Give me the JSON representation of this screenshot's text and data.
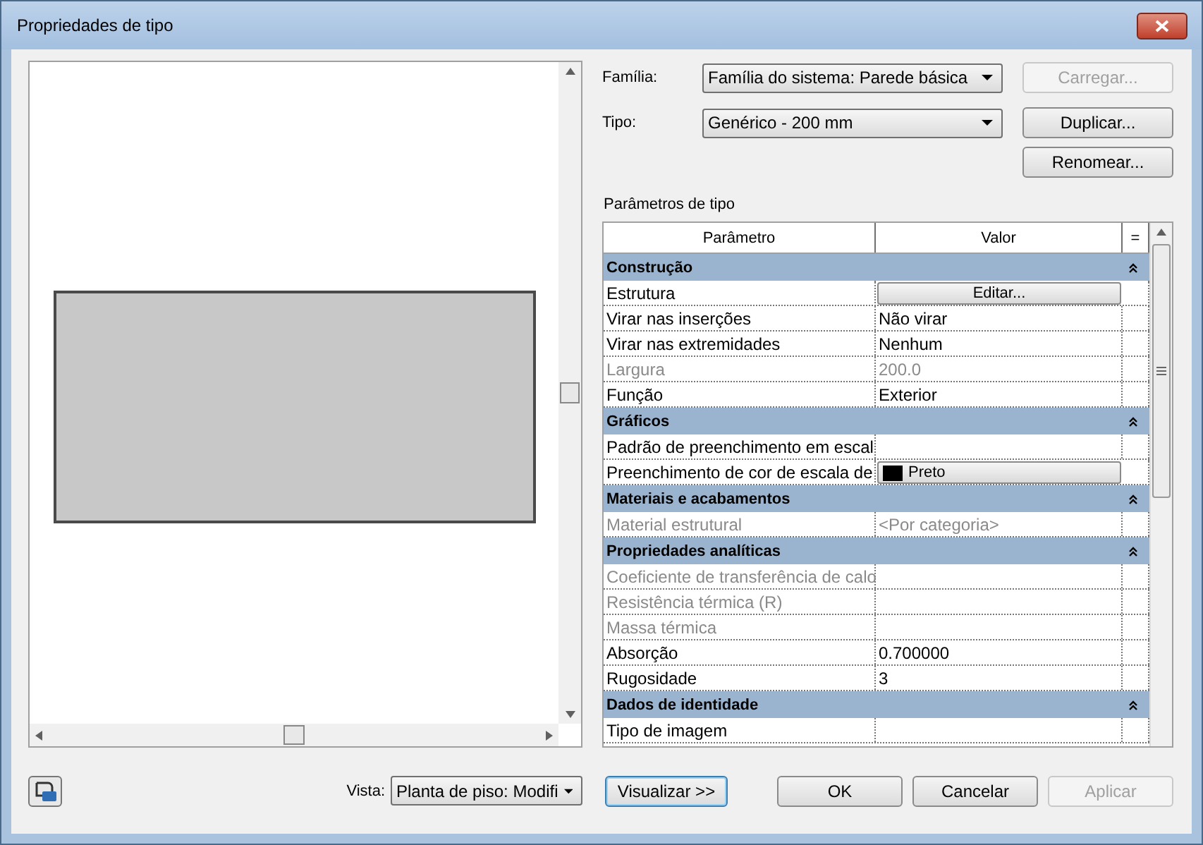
{
  "window": {
    "title": "Propriedades de tipo"
  },
  "fields": [
    {
      "label": "Família:",
      "value": "Família do sistema: Parede básica",
      "button": {
        "label": "Carregar...",
        "disabled": true
      }
    },
    {
      "label": "Tipo:",
      "value": "Genérico - 200 mm",
      "button": {
        "label": "Duplicar...",
        "disabled": false
      }
    }
  ],
  "rename_button": {
    "label": "Renomear...",
    "disabled": false
  },
  "table": {
    "caption": "Parâmetros de tipo",
    "columns": [
      "Parâmetro",
      "Valor",
      "="
    ],
    "groups": [
      {
        "title": "Construção",
        "expanded": true,
        "rows": [
          {
            "name": "Estrutura",
            "kind": "button",
            "value": "Editar...",
            "disabled": false
          },
          {
            "name": "Virar nas inserções",
            "kind": "text",
            "value": "Não virar",
            "disabled": false
          },
          {
            "name": "Virar nas extremidades",
            "kind": "text",
            "value": "Nenhum",
            "disabled": false
          },
          {
            "name": "Largura",
            "kind": "text",
            "value": "200.0",
            "disabled": true
          },
          {
            "name": "Função",
            "kind": "text",
            "value": "Exterior",
            "disabled": false
          }
        ]
      },
      {
        "title": "Gráficos",
        "expanded": true,
        "rows": [
          {
            "name": "Padrão de preenchimento em escal",
            "kind": "text",
            "disabled": false
          },
          {
            "name": "Preenchimento de cor de escala de",
            "kind": "color",
            "value": "Preto",
            "color": "#000000",
            "disabled": false
          }
        ]
      },
      {
        "title": "Materiais e acabamentos",
        "expanded": true,
        "rows": [
          {
            "name": "Material estrutural",
            "kind": "text",
            "value": "<Por categoria>",
            "disabled": true
          }
        ]
      },
      {
        "title": "Propriedades analíticas",
        "expanded": true,
        "rows": [
          {
            "name": "Coeficiente de transferência de calo",
            "kind": "text",
            "disabled": true
          },
          {
            "name": "Resistência térmica (R)",
            "kind": "text",
            "disabled": true
          },
          {
            "name": "Massa térmica",
            "kind": "text",
            "disabled": true
          },
          {
            "name": "Absorção",
            "kind": "text",
            "value": "0.700000",
            "disabled": false
          },
          {
            "name": "Rugosidade",
            "kind": "text",
            "value": "3",
            "disabled": false
          }
        ]
      },
      {
        "title": "Dados de identidade",
        "expanded": true,
        "rows": [
          {
            "name": "Tipo de imagem",
            "kind": "text",
            "disabled": false
          }
        ]
      }
    ]
  },
  "footer": {
    "view_label": "Vista:",
    "view_value": "Planta de piso: Modifi",
    "preview_button": {
      "label": "Visualizar >>",
      "selected": true
    },
    "buttons": [
      {
        "label": "OK",
        "disabled": false
      },
      {
        "label": "Cancelar",
        "disabled": false
      },
      {
        "label": "Aplicar",
        "disabled": true
      }
    ]
  }
}
